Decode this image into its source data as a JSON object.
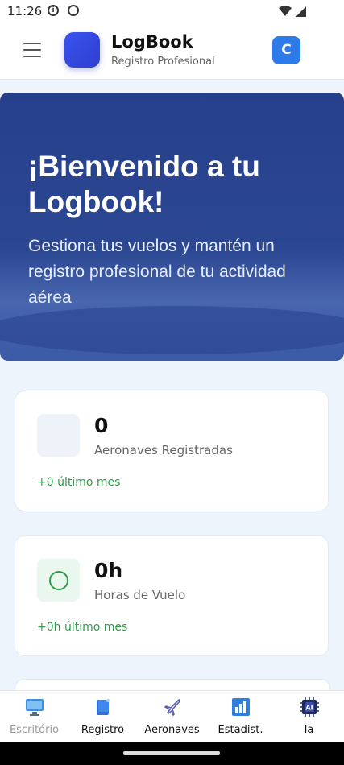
{
  "status": {
    "time": "11:26"
  },
  "header": {
    "title": "LogBook",
    "subtitle": "Registro Profesional",
    "avatar_letter": "C"
  },
  "hero": {
    "title": "¡Bienvenido a tu Logbook!",
    "subtitle": "Gestiona tus vuelos y mantén un registro profesional de tu actividad aérea"
  },
  "stats": [
    {
      "value": "0",
      "label": "Aeronaves Registradas",
      "delta": "+0 último mes"
    },
    {
      "value": "0h",
      "label": "Horas de Vuelo",
      "delta": "+0h último mes"
    }
  ],
  "nav": {
    "items": [
      {
        "label": "Escritório",
        "icon": "desktop-icon",
        "active": true
      },
      {
        "label": "Registro",
        "icon": "logbook-icon",
        "active": false
      },
      {
        "label": "Aeronaves",
        "icon": "airplane-icon",
        "active": false
      },
      {
        "label": "Estadist.",
        "icon": "bar-chart-icon",
        "active": false
      },
      {
        "label": "Ia",
        "icon": "ai-chip-icon",
        "active": false
      }
    ]
  },
  "colors": {
    "accent": "#2d7be8",
    "brand": "#3a52f0",
    "positive": "#2e9b4a",
    "hero": "#2c4792"
  }
}
